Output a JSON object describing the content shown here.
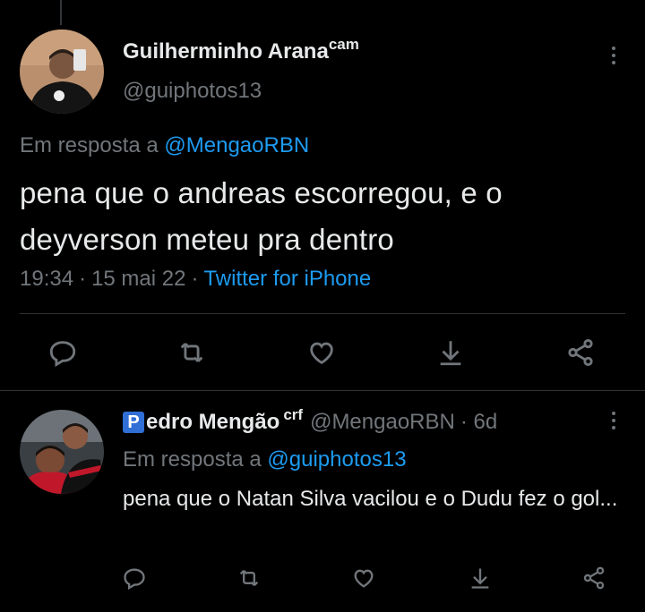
{
  "main_tweet": {
    "display_name": "Guilherminho Arana",
    "name_suffix": "cam",
    "handle": "@guiphotos13",
    "reply_prefix": "Em resposta a",
    "reply_to": "@MengaoRBN",
    "text": "pena que o andreas escorregou, e o deyverson meteu pra dentro",
    "time": "19:34",
    "date": "15 mai 22",
    "source": "Twitter for iPhone",
    "dot": "·"
  },
  "reply_tweet": {
    "badge": "P",
    "display_name": "edro Mengão",
    "name_suffix": "crf",
    "handle": "@MengaoRBN",
    "age": "6d",
    "dot": "·",
    "reply_prefix": "Em resposta a",
    "reply_to": "@guiphotos13",
    "text": "pena que o Natan Silva vacilou e o Dudu fez o gol..."
  },
  "icons": {
    "reply": "reply-icon",
    "retweet": "retweet-icon",
    "like": "heart-icon",
    "download": "download-icon",
    "share": "share-icon",
    "more": "more-vertical-icon"
  },
  "colors": {
    "background": "#000000",
    "text": "#e7e9ea",
    "muted": "#71767b",
    "link": "#1d9bf0",
    "divider": "#2f3336",
    "badge": "#2f6fd6"
  }
}
